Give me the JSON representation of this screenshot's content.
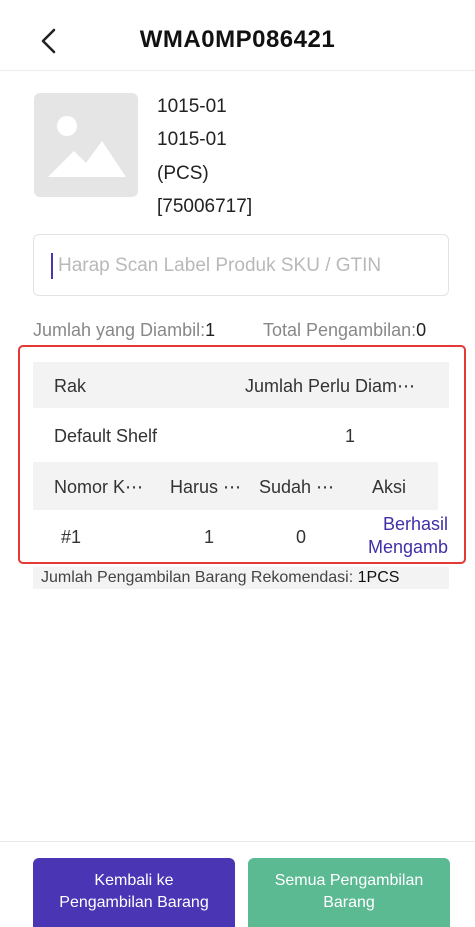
{
  "header": {
    "title": "WMA0MP086421"
  },
  "product": {
    "line1": "1015-01",
    "line2": "1015-01",
    "unit": "(PCS)",
    "code": "[75006717]"
  },
  "scan": {
    "placeholder": "Harap Scan Label Produk SKU / GTIN"
  },
  "stats": {
    "picked_label": "Jumlah yang Diambil:",
    "picked_value": "1",
    "total_label": "Total Pengambilan:",
    "total_value": "0"
  },
  "shelf_table": {
    "headers": [
      "Rak",
      "Jumlah Perlu Diam⋯"
    ],
    "row": [
      "Default Shelf",
      "1"
    ]
  },
  "box_table": {
    "headers": [
      "Nomor K⋯",
      "Harus ⋯",
      "Sudah ⋯",
      "Aksi"
    ],
    "row": [
      "#1",
      "1",
      "0"
    ],
    "action_line1": "Berhasil",
    "action_line2": "Mengamb"
  },
  "recommendation": {
    "label": "Jumlah Pengambilan Barang Rekomendasi: ",
    "value": "1PCS"
  },
  "buttons": {
    "back_line1": "Kembali ke",
    "back_line2": "Pengambilan Barang",
    "all_line1": "Semua Pengambilan",
    "all_line2": "Barang"
  },
  "colors": {
    "primary": "#4a35b5",
    "success": "#5cba93",
    "highlight_border": "#e53935",
    "link": "#3f2fa8"
  },
  "icons": {
    "back": "chevron-left-icon",
    "image": "image-placeholder-icon"
  }
}
